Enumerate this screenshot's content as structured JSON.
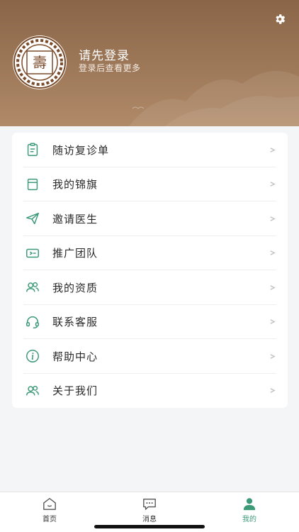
{
  "header": {
    "login_title": "请先登录",
    "login_subtitle": "登录后查看更多",
    "settings_icon": "gear-icon",
    "avatar_logo_text": "壽"
  },
  "menu": {
    "items": [
      {
        "label": "随访复诊单",
        "icon": "clipboard-icon"
      },
      {
        "label": "我的锦旗",
        "icon": "banner-icon"
      },
      {
        "label": "邀请医生",
        "icon": "paper-plane-icon"
      },
      {
        "label": "推广团队",
        "icon": "ticket-icon"
      },
      {
        "label": "我的资质",
        "icon": "users-icon"
      },
      {
        "label": "联系客服",
        "icon": "headset-icon"
      },
      {
        "label": "帮助中心",
        "icon": "info-icon"
      },
      {
        "label": "关于我们",
        "icon": "users-icon"
      }
    ]
  },
  "tabbar": {
    "tabs": [
      {
        "label": "首页",
        "icon": "home-icon",
        "active": false
      },
      {
        "label": "消息",
        "icon": "message-icon",
        "active": false
      },
      {
        "label": "我的",
        "icon": "user-icon",
        "active": true
      }
    ]
  },
  "colors": {
    "accent": "#3d9a78",
    "header_brown": "#9a7556",
    "background": "#f4f5f7"
  }
}
